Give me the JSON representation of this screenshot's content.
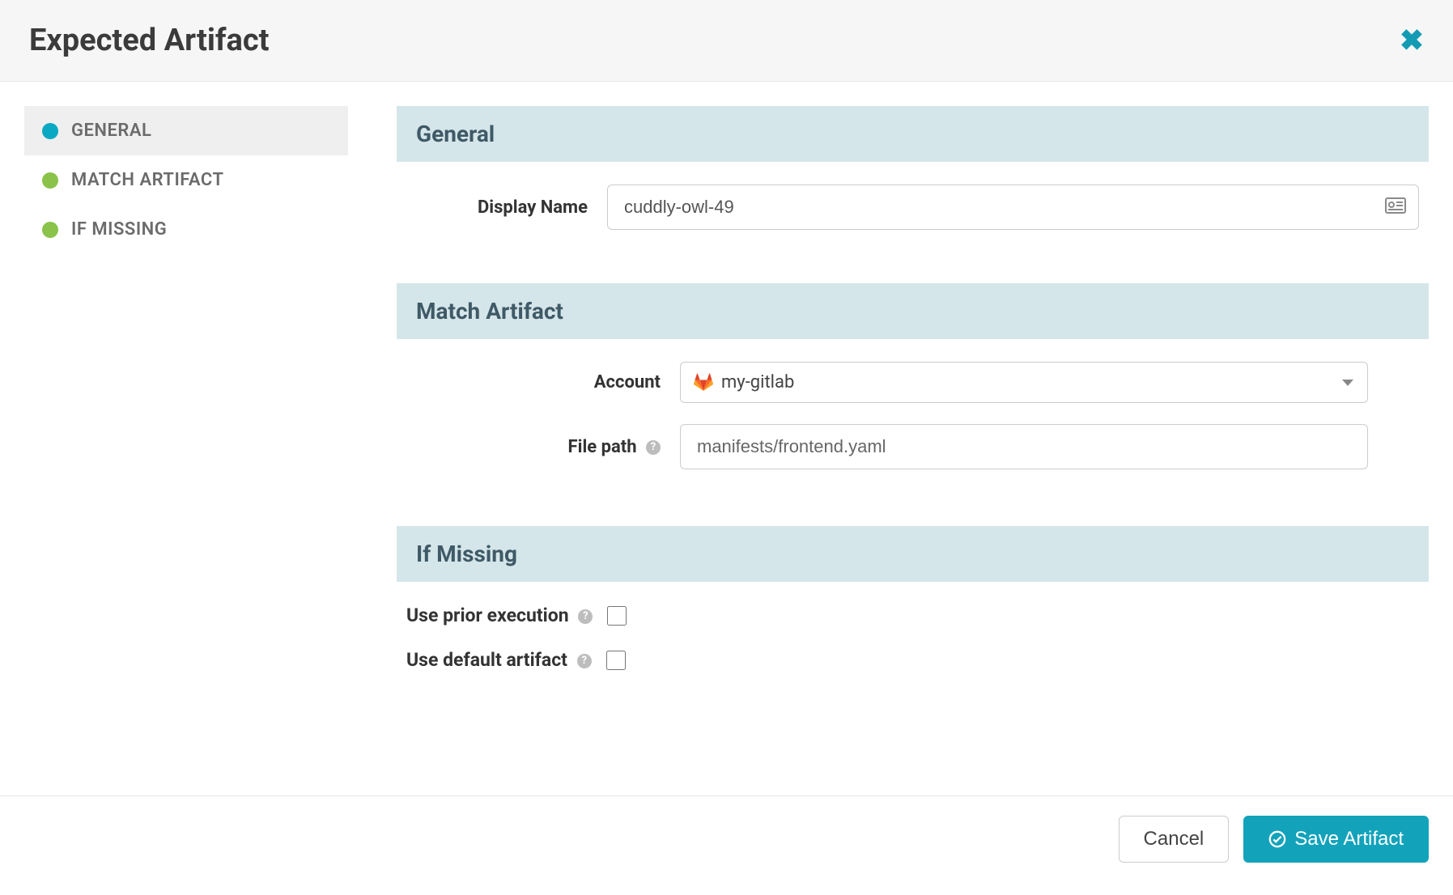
{
  "modal": {
    "title": "Expected Artifact"
  },
  "sidebar": {
    "items": [
      {
        "label": "GENERAL",
        "active": true,
        "dot": "teal"
      },
      {
        "label": "MATCH ARTIFACT",
        "active": false,
        "dot": "green"
      },
      {
        "label": "IF MISSING",
        "active": false,
        "dot": "green"
      }
    ]
  },
  "sections": {
    "general": {
      "title": "General",
      "displayName": {
        "label": "Display Name",
        "value": "cuddly-owl-49"
      }
    },
    "match": {
      "title": "Match Artifact",
      "account": {
        "label": "Account",
        "value": "my-gitlab"
      },
      "filepath": {
        "label": "File path",
        "value": "manifests/frontend.yaml"
      }
    },
    "ifMissing": {
      "title": "If Missing",
      "usePrior": {
        "label": "Use prior execution",
        "checked": false
      },
      "useDefault": {
        "label": "Use default artifact",
        "checked": false
      }
    }
  },
  "footer": {
    "cancel": "Cancel",
    "save": "Save Artifact"
  }
}
